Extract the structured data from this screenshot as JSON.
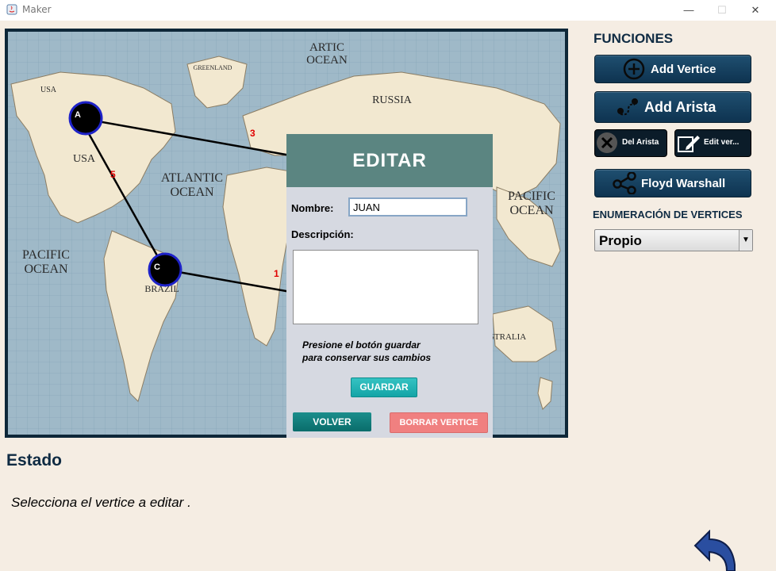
{
  "window": {
    "title": "Maker"
  },
  "map": {
    "labels": {
      "artic": [
        "ARTIC",
        "OCEAN"
      ],
      "greenland": "GREENLAND",
      "russia": "RUSSIA",
      "usa_small": "USA",
      "usa": "USA",
      "atlantic": [
        "ATLANTIC",
        "OCEAN"
      ],
      "pacific_right": [
        "PACIFIC",
        "OCEAN"
      ],
      "pacific_left": [
        "PACIFIC",
        "OCEAN"
      ],
      "brazil": "BRAZIL",
      "australia_partial": "STRALIA"
    },
    "vertices": [
      {
        "label": "A"
      },
      {
        "label": "C"
      }
    ],
    "edge_weights": [
      "5",
      "3",
      "1"
    ]
  },
  "sidebar": {
    "heading": "FUNCIONES",
    "add_vertice": "Add Vertice",
    "add_arista": "Add Arista",
    "del_arista": "Del Arista",
    "edit_vertice": "Edit ver...",
    "floyd": "Floyd Warshall",
    "enum_heading": "ENUMERACIÓN DE VERTICES",
    "enum_selected": "Propio"
  },
  "editar": {
    "title": "EDITAR",
    "nombre_label": "Nombre:",
    "nombre_value": "JUAN",
    "descripcion_label": "Descripción:",
    "hint": [
      "Presione el botón guardar",
      "para conservar sus cambios"
    ],
    "guardar": "GUARDAR",
    "volver": "VOLVER",
    "borrar": "BORRAR VERTICE"
  },
  "estado": {
    "title": "Estado",
    "message": "Selecciona el vertice a editar ."
  }
}
